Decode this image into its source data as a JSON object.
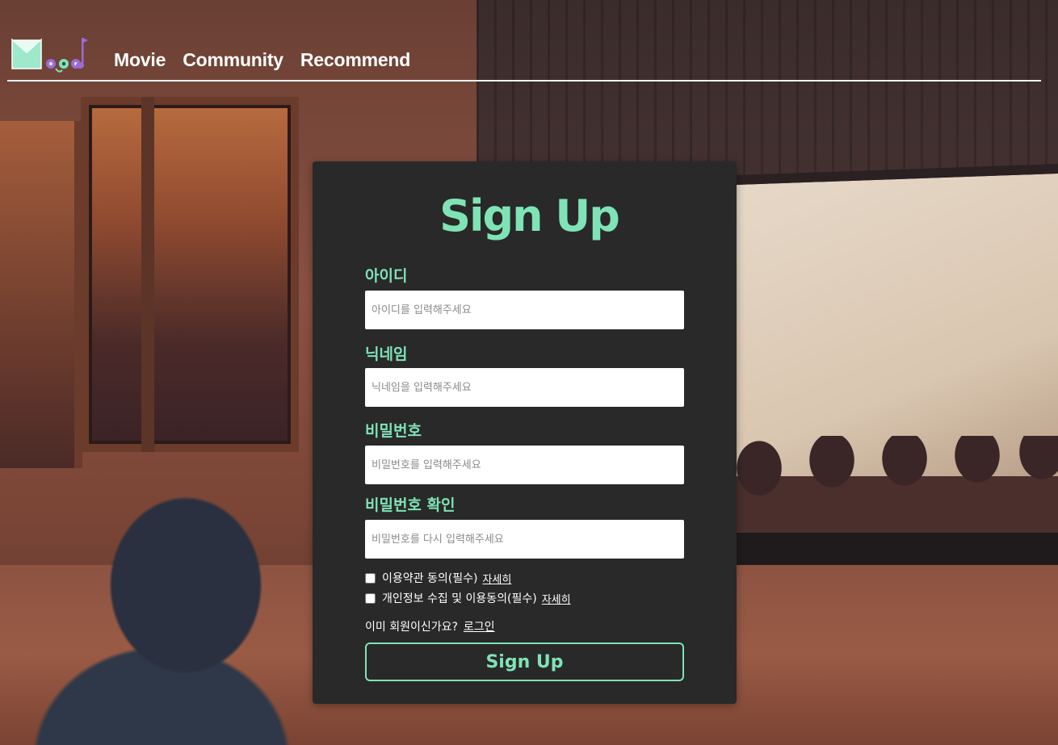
{
  "nav": {
    "items": [
      "Movie",
      "Community",
      "Recommend"
    ]
  },
  "signup": {
    "title": "Sign Up",
    "fields": [
      {
        "label": "아이디",
        "placeholder": "아이디를 입력해주세요",
        "value": ""
      },
      {
        "label": "닉네임",
        "placeholder": "닉네임을 입력해주세요",
        "value": ""
      },
      {
        "label": "비밀번호",
        "placeholder": "비밀번호를 입력해주세요",
        "value": ""
      },
      {
        "label": "비밀번호 확인",
        "placeholder": "비밀번호를 다시 입력해주세요",
        "value": ""
      }
    ],
    "agreements": [
      {
        "text": "이용약관 동의(필수)",
        "detail": "자세히",
        "checked": false
      },
      {
        "text": "개인정보 수집 및 이용동의(필수)",
        "detail": "자세히",
        "checked": false
      }
    ],
    "login_prompt": "이미 회원이신가요?",
    "login_link": "로그인",
    "submit_label": "Sign Up"
  },
  "colors": {
    "accent": "#7fe3b6",
    "card_bg": "#292929",
    "logo_purple": "#9b6bd6"
  },
  "icons": {
    "logo": "mood-logo",
    "music_note": "music-note-icon"
  }
}
